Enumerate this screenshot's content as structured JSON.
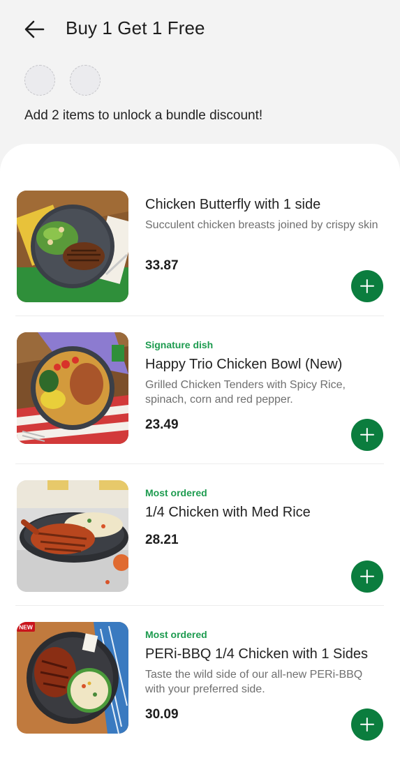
{
  "header": {
    "title": "Buy 1 Get 1 Free",
    "back_icon": "arrow-left-icon"
  },
  "bundle": {
    "slots_count": 2,
    "message": "Add 2 items to unlock a bundle discount!"
  },
  "items": [
    {
      "tag": "",
      "name": "Chicken Butterfly  with 1 side",
      "description": "Succulent chicken breasts joined by crispy skin",
      "price": "33.87",
      "add_icon": "plus-icon"
    },
    {
      "tag": "Signature dish",
      "name": "Happy Trio Chicken Bowl (New)",
      "description": "Grilled Chicken Tenders with Spicy Rice, spinach, corn and red pepper.",
      "price": "23.49",
      "add_icon": "plus-icon"
    },
    {
      "tag": "Most ordered",
      "name": "1/4 Chicken with Med Rice",
      "description": "",
      "price": "28.21",
      "add_icon": "plus-icon"
    },
    {
      "tag": "Most ordered",
      "name": "PERi-BBQ 1/4 Chicken with 1 Sides",
      "description": "Taste the wild side of our all-new PERi-BBQ with your preferred side.",
      "price": "30.09",
      "add_icon": "plus-icon",
      "image_badge": "NEW"
    }
  ],
  "colors": {
    "accent_green": "#0b7d3e",
    "tag_green": "#1d9b4f"
  }
}
